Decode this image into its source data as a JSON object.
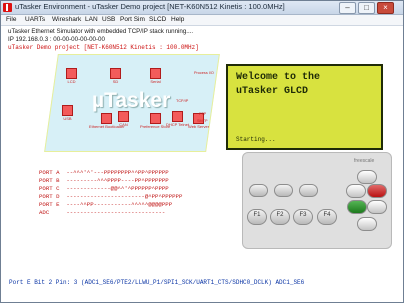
{
  "window": {
    "title": "uTasker Environment - uTasker Demo project [NET-K60N512 Kinetis : 100.0MHz]",
    "buttons": [
      "–",
      "□",
      "×"
    ]
  },
  "menu": [
    "File",
    "UARTs",
    "Wireshark",
    "LAN",
    "USB",
    "Port Sim",
    "SLCD",
    "Help"
  ],
  "status": {
    "line1": "uTasker Ethernet Simulator with embedded TCP/IP stack running....",
    "line2": "IP 192.168.0.3 : 00-00-00-00-00-00",
    "line3": "uTasker Demo project [NET-K60N512 Kinetis : 100.0MHz]"
  },
  "banner": {
    "logo": "µTasker",
    "labels": {
      "lcd": "LCD",
      "sd": "SD",
      "serial": "Serial",
      "usb": "USB",
      "can": "CAN",
      "ethernet_bootloader": "Ethernet\nBootloader",
      "preference_store": "Preference\nStore",
      "dhcp": "DHCP\nTelnet",
      "web_server": "Web Server",
      "process_io": "Process\nI/O",
      "tcpip": "TCP/IP",
      "ftp": "FTP",
      "smtp": "SMTP"
    }
  },
  "glcd": {
    "line1": "Welcome to the",
    "line2": "uTasker GLCD",
    "line3": "Starting..."
  },
  "ports": [
    {
      "label": "PORT A",
      "bits": "--^^^'^'---PPPPPPPP^^PP^PPPPPP"
    },
    {
      "label": "PORT B",
      "bits": "---------^^^PPPP----PP^PPPPPPP"
    },
    {
      "label": "PORT C",
      "bits": "-------------@@^^'^PPPPPP^PPPP"
    },
    {
      "label": "PORT D",
      "bits": "-----------------------@^PP^PPPPPP"
    },
    {
      "label": "PORT E",
      "bits": "----^^PP-----------^^^^^@@@@PPP"
    },
    {
      "label": "ADC",
      "bits": "-----------------------------"
    }
  ],
  "keypad": {
    "brand": "freescale",
    "keys": [
      "F1",
      "F2",
      "F3",
      "F4"
    ]
  },
  "bottom_status": "Port E Bit 2 Pin: 3 (ADC1_SE6/PTE2/LLWU_P1/SPI1_SCK/UART1_CTS/SDHC0_DCLK) ADC1_SE6",
  "colors": {
    "title_bar": "#c8d6e8",
    "glcd_bg": "#d8e23f",
    "port_text": "#c01717",
    "status_blue": "#0b35a5"
  }
}
